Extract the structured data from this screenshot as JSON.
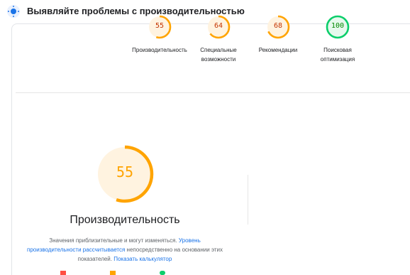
{
  "header": {
    "title": "Выявляйте проблемы с производительностью",
    "icon": "lighthouse-icon"
  },
  "colors": {
    "average": "#ffa400",
    "average_bg": "#fff3e0",
    "average_text": "#c33300",
    "pass": "#0cce6b",
    "pass_bg": "#e6f9ed",
    "pass_text": "#008800",
    "link": "#1a73e8"
  },
  "gauges": [
    {
      "score": 55,
      "label": "Производительность",
      "status": "average"
    },
    {
      "score": 64,
      "label": "Специальные возможности",
      "status": "average"
    },
    {
      "score": 68,
      "label": "Рекомендации",
      "status": "average"
    },
    {
      "score": 100,
      "label": "Поисковая оптимизация",
      "status": "pass"
    }
  ],
  "main": {
    "score": 55,
    "title": "Производительность",
    "desc_text_1": "Значения приблизительные и могут изменяться.",
    "desc_link_1": "Уровень производительности рассчитывается",
    "desc_text_2": "непосредственно на основании этих показателей.",
    "desc_link_2": "Показать калькулятор"
  }
}
